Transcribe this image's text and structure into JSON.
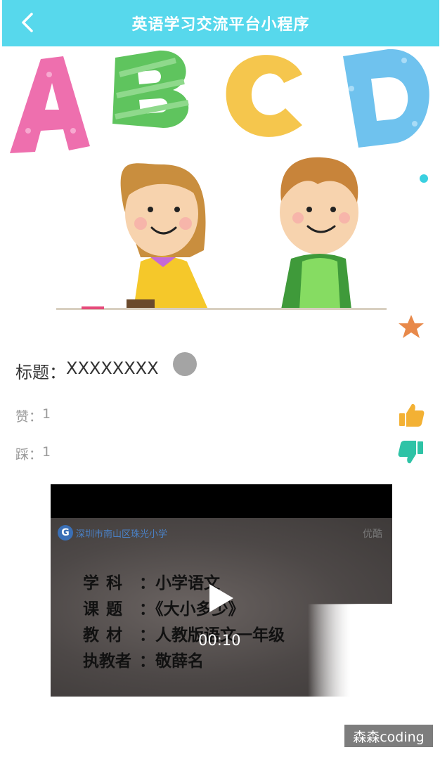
{
  "navbar": {
    "title": "英语学习交流平台小程序"
  },
  "hero": {
    "letters": [
      "A",
      "B",
      "C",
      "D"
    ]
  },
  "post": {
    "title_label": "标题：",
    "title_value": "XXXXXXXX",
    "like_label": "赞：",
    "like_count": "1",
    "dislike_label": "踩：",
    "dislike_count": "1"
  },
  "video": {
    "logo_text": "深圳市南山区珠光小学",
    "watermark": "优酷",
    "lines": [
      {
        "label": "学科",
        "value": "：小学语文"
      },
      {
        "label": "课题",
        "value": "：《大小多少》"
      },
      {
        "label": "教材",
        "value": "：人教版语文一年级"
      },
      {
        "label": "执教者",
        "value": "：敬薛名"
      }
    ],
    "time": "00:10"
  },
  "badge": {
    "text": "森森coding"
  },
  "colors": {
    "navbar": "#57d8ec",
    "star": "#e8894a",
    "like": "#f3b134",
    "dislike": "#2ec3a6"
  }
}
